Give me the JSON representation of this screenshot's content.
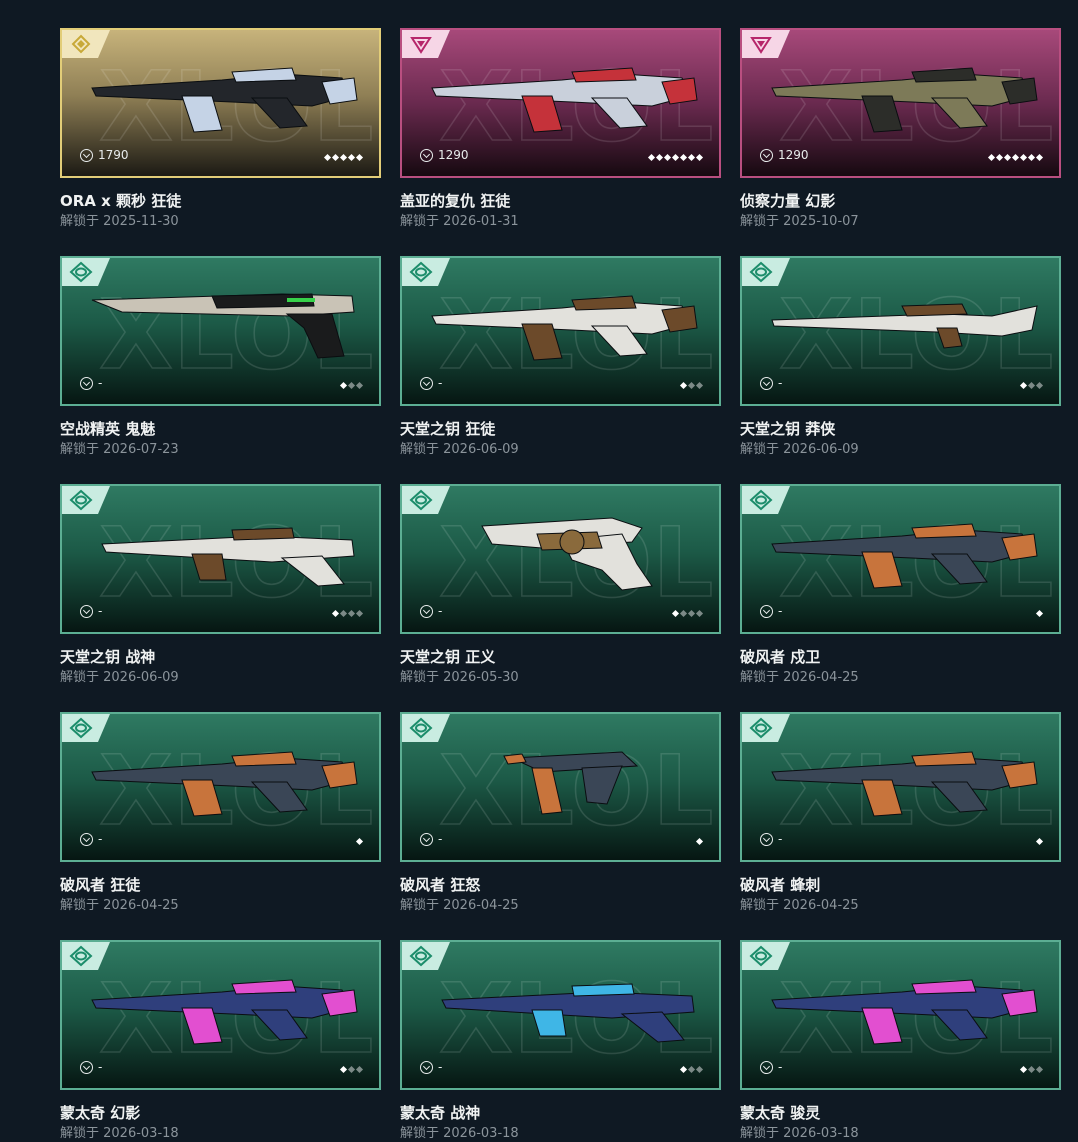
{
  "skins": [
    {
      "tier": "gold",
      "badge": "diamond",
      "price": "1790",
      "levels_total": 5,
      "levels_on": 5,
      "name": "ORA x 颗秒 狂徒",
      "date": "解锁于 2025-11-30",
      "weapon": "rifle-vandal",
      "colors": [
        "#23262b",
        "#c5d3e6"
      ]
    },
    {
      "tier": "pink",
      "badge": "triangle",
      "price": "1290",
      "levels_total": 7,
      "levels_on": 7,
      "name": "盖亚的复仇 狂徒",
      "date": "解锁于 2026-01-31",
      "weapon": "rifle-ak",
      "colors": [
        "#c9d0db",
        "#c5323a"
      ]
    },
    {
      "tier": "pink",
      "badge": "triangle",
      "price": "1290",
      "levels_total": 7,
      "levels_on": 7,
      "name": "侦察力量 幻影",
      "date": "解锁于 2025-10-07",
      "weapon": "rifle-phantom",
      "colors": [
        "#7d7a58",
        "#2c2d29"
      ]
    },
    {
      "tier": "green",
      "badge": "eye",
      "price": "-",
      "levels_total": 3,
      "levels_on": 1,
      "name": "空战精英 鬼魅",
      "date": "解锁于 2026-07-23",
      "weapon": "pistol-ghost",
      "colors": [
        "#c9c3b6",
        "#1a1b1c"
      ]
    },
    {
      "tier": "green",
      "badge": "eye",
      "price": "-",
      "levels_total": 3,
      "levels_on": 1,
      "name": "天堂之钥 狂徒",
      "date": "解锁于 2026-06-09",
      "weapon": "rifle-ak",
      "colors": [
        "#e2e1dc",
        "#6c4a2a"
      ]
    },
    {
      "tier": "green",
      "badge": "eye",
      "price": "-",
      "levels_total": 3,
      "levels_on": 1,
      "name": "天堂之钥 莽侠",
      "date": "解锁于 2026-06-09",
      "weapon": "sniper",
      "colors": [
        "#e2e1dc",
        "#6c4a2a"
      ]
    },
    {
      "tier": "green",
      "badge": "eye",
      "price": "-",
      "levels_total": 4,
      "levels_on": 1,
      "name": "天堂之钥 战神",
      "date": "解锁于 2026-06-09",
      "weapon": "lmg",
      "colors": [
        "#e2e1dc",
        "#6c4a2a"
      ]
    },
    {
      "tier": "green",
      "badge": "eye",
      "price": "-",
      "levels_total": 4,
      "levels_on": 1,
      "name": "天堂之钥 正义",
      "date": "解锁于 2026-05-30",
      "weapon": "revolver",
      "colors": [
        "#e2e1dc",
        "#8a6a3c"
      ]
    },
    {
      "tier": "green",
      "badge": "eye",
      "price": "-",
      "levels_total": 1,
      "levels_on": 1,
      "name": "破风者 戍卫",
      "date": "解锁于 2026-04-25",
      "weapon": "rifle-guardian",
      "colors": [
        "#3a4656",
        "#c8743c"
      ]
    },
    {
      "tier": "green",
      "badge": "eye",
      "price": "-",
      "levels_total": 1,
      "levels_on": 1,
      "name": "破风者 狂徒",
      "date": "解锁于 2026-04-25",
      "weapon": "rifle-ak",
      "colors": [
        "#3a4656",
        "#c8743c"
      ]
    },
    {
      "tier": "green",
      "badge": "eye",
      "price": "-",
      "levels_total": 1,
      "levels_on": 1,
      "name": "破风者 狂怒",
      "date": "解锁于 2026-04-25",
      "weapon": "smg-frenzy",
      "colors": [
        "#3a4656",
        "#c8743c"
      ]
    },
    {
      "tier": "green",
      "badge": "eye",
      "price": "-",
      "levels_total": 1,
      "levels_on": 1,
      "name": "破风者 蜂刺",
      "date": "解锁于 2026-04-25",
      "weapon": "smg-stinger",
      "colors": [
        "#3a4656",
        "#c8743c"
      ]
    },
    {
      "tier": "green",
      "badge": "eye",
      "price": "-",
      "levels_total": 3,
      "levels_on": 1,
      "name": "蒙太奇 幻影",
      "date": "解锁于 2026-03-18",
      "weapon": "rifle-phantom",
      "colors": [
        "#2f3f7c",
        "#e24fd0"
      ]
    },
    {
      "tier": "green",
      "badge": "eye",
      "price": "-",
      "levels_total": 3,
      "levels_on": 1,
      "name": "蒙太奇 战神",
      "date": "解锁于 2026-03-18",
      "weapon": "lmg",
      "colors": [
        "#2f3f7c",
        "#3fb6e6"
      ]
    },
    {
      "tier": "green",
      "badge": "eye",
      "price": "-",
      "levels_total": 3,
      "levels_on": 1,
      "name": "蒙太奇 骏灵",
      "date": "解锁于 2026-03-18",
      "weapon": "smg-spectre",
      "colors": [
        "#2f3f7c",
        "#e24fd0"
      ]
    }
  ],
  "watermark_text": "XLOL"
}
